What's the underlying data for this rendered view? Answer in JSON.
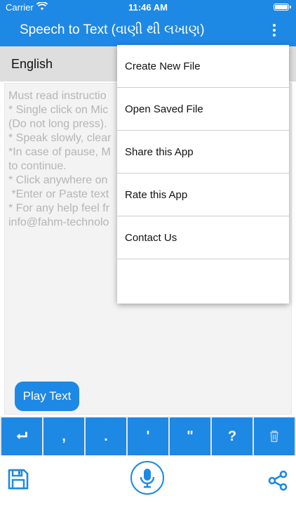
{
  "status": {
    "carrier": "Carrier",
    "time": "11:46 AM"
  },
  "appbar": {
    "title": "Speech to Text (વાણી થી લખાણ)",
    "menu_icon": "more-vertical-icon"
  },
  "language": {
    "selected": "English"
  },
  "editor": {
    "lines": [
      "Must read instructio",
      "* Single click on Mic",
      "(Do not long press).",
      "* Speak slowly, clear",
      "*In case of pause, M",
      "to continue.",
      "* Click anywhere on",
      " *Enter or Paste text",
      "* For any help feel fr",
      "info@fahm-technolo"
    ]
  },
  "play_button": {
    "label": "Play Text"
  },
  "keys": [
    {
      "name": "enter",
      "label": ""
    },
    {
      "name": "comma",
      "label": ","
    },
    {
      "name": "period",
      "label": "."
    },
    {
      "name": "apostrophe",
      "label": "'"
    },
    {
      "name": "quote",
      "label": "\""
    },
    {
      "name": "question",
      "label": "?"
    },
    {
      "name": "delete",
      "label": ""
    }
  ],
  "menu": {
    "items": [
      {
        "label": "Create New File"
      },
      {
        "label": "Open Saved File"
      },
      {
        "label": "Share this App"
      },
      {
        "label": "Rate this App"
      },
      {
        "label": "Contact Us"
      }
    ]
  },
  "colors": {
    "primary": "#1e88e5",
    "lang_bar": "#dedede",
    "placeholder": "#b5b5b5"
  }
}
